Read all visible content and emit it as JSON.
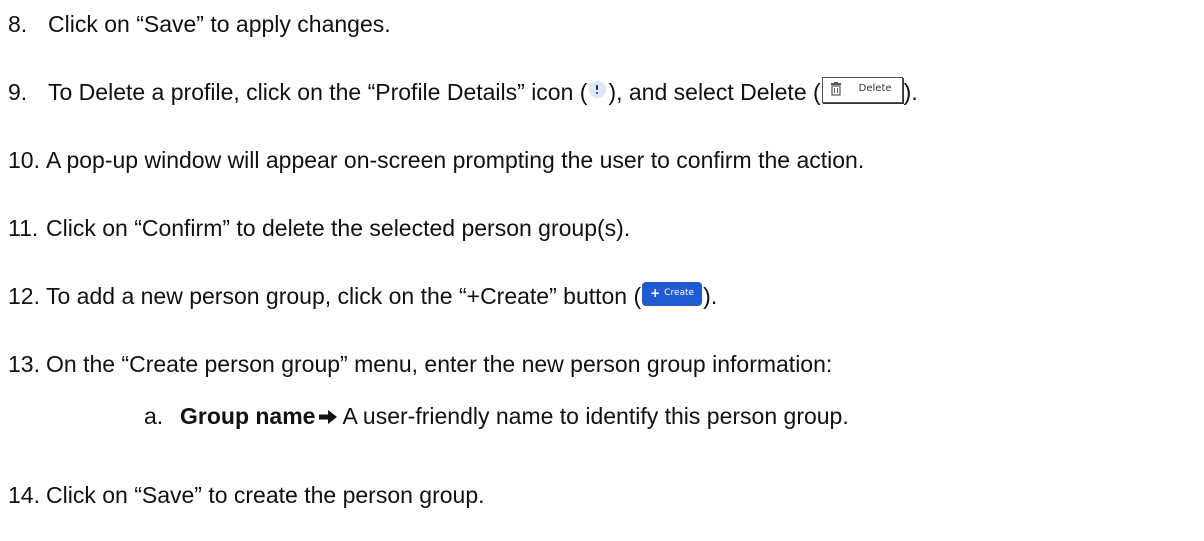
{
  "steps": [
    {
      "num": "8.",
      "text": "Click on “Save” to apply changes."
    },
    {
      "num": "9.",
      "pre": "To Delete a profile, click on the “Profile Details” icon (",
      "mid": "), and select Delete (",
      "post": ")."
    },
    {
      "num": "10.",
      "text": "A pop-up window will appear on-screen prompting the user to confirm the action."
    },
    {
      "num": "11.",
      "text": "Click on “Confirm” to delete the selected person group(s)."
    },
    {
      "num": "12.",
      "pre": "To add a new person group, click on the “+Create” button (",
      "post": ")."
    },
    {
      "num": "13.",
      "text": "On the “Create person group” menu, enter the new person group information:"
    },
    {
      "num": "14.",
      "text": "Click on “Save” to create the person group."
    }
  ],
  "substep": {
    "letter": "a.",
    "term": "Group name",
    "icon": "right-arrow-icon",
    "description": "A user-friendly name to identify this person group."
  },
  "widgets": {
    "delete_button": {
      "label": "Delete",
      "icon": "trash-icon"
    },
    "create_button": {
      "plus": "+",
      "label": "Create",
      "color": "#1f5bd2"
    },
    "profile_details_icon": {
      "icon": "info-icon"
    }
  }
}
